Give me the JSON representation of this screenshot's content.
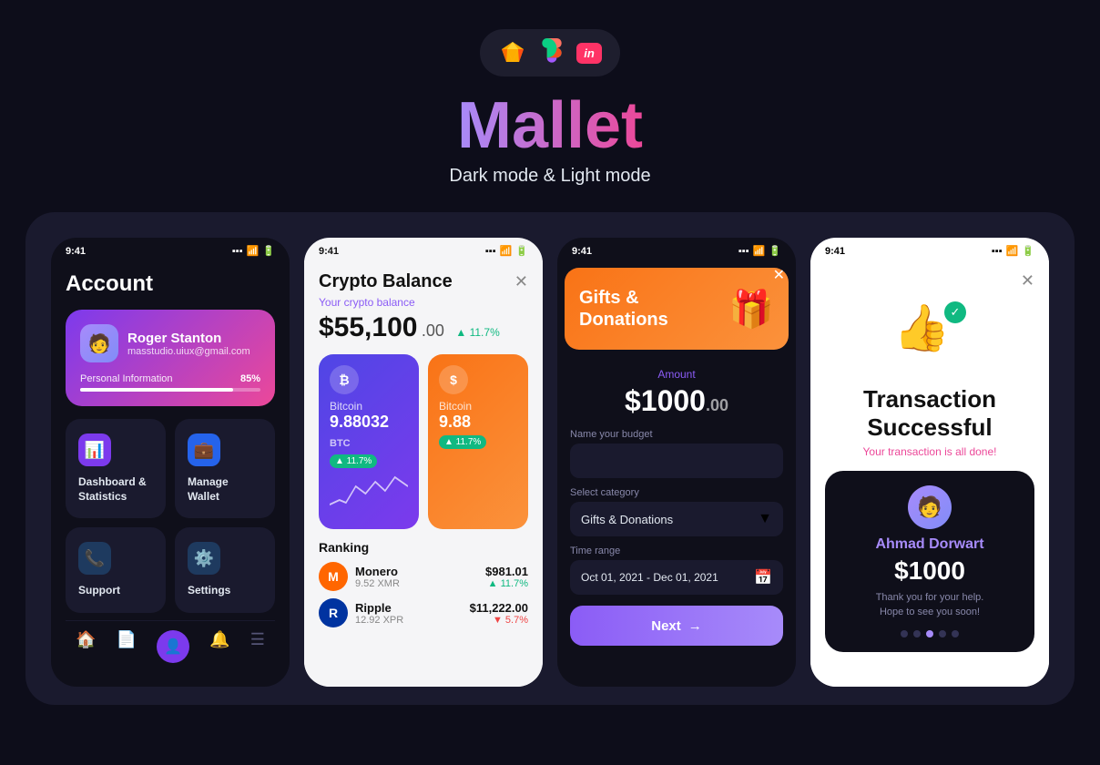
{
  "header": {
    "title": "Mallet",
    "subtitle": "Dark mode & Light mode",
    "tools": [
      "sketch",
      "figma",
      "invision"
    ]
  },
  "phone1": {
    "status_time": "9:41",
    "title": "Account",
    "user": {
      "name": "Roger Stanton",
      "email": "masstudio.uiux@gmail.com",
      "progress": 85,
      "progress_label": "Personal Information",
      "progress_pct": "85%"
    },
    "menu": [
      {
        "label": "Dashboard &\nStatistics",
        "icon": "📊",
        "icon_class": "menu-icon-dashboard"
      },
      {
        "label": "Manage\nWallet",
        "icon": "💼",
        "icon_class": "menu-icon-wallet"
      },
      {
        "label": "Support",
        "icon": "📞",
        "icon_class": "menu-icon-support"
      },
      {
        "label": "Settings",
        "icon": "⚙️",
        "icon_class": "menu-icon-settings"
      }
    ]
  },
  "phone2": {
    "status_time": "9:41",
    "title": "Crypto Balance",
    "balance_label": "Your crypto balance",
    "balance": "$55,100",
    "balance_cents": ".00",
    "balance_change": "▲ 11.7%",
    "cards": [
      {
        "icon": "₿",
        "name": "Bitcoin",
        "value": "9.88032",
        "unit": "BTC",
        "change": "▲ 11.7%"
      },
      {
        "icon": "$",
        "name": "Bitcoin",
        "value": "9.88",
        "unit": "",
        "change": "▲ 11.7%"
      }
    ],
    "ranking_title": "Ranking",
    "coins": [
      {
        "name": "Monero",
        "amount": "9.52 XMR",
        "price": "$981.01",
        "change": "▲ 11.7%",
        "change_up": true,
        "icon": "M"
      },
      {
        "name": "Ripple",
        "amount": "12.92 XPR",
        "price": "$11,222.00",
        "change": "▼ 5.7%",
        "change_up": false,
        "icon": "R"
      }
    ]
  },
  "phone3": {
    "status_time": "9:41",
    "banner_title": "Gifts &\nDonations",
    "amount_label": "Amount",
    "amount": "$1000",
    "amount_cents": ".00",
    "budget_label": "Name your budget",
    "category_label": "Select category",
    "category_value": "Gifts & Donations",
    "time_label": "Time range",
    "time_value": "Oct 01, 2021 - Dec 01, 2021",
    "next_btn": "Next"
  },
  "phone4": {
    "status_time": "9:41",
    "title": "Transaction\nSuccessful",
    "subtitle": "Your transaction is all done!",
    "recipient_name": "Ahmad Dorwart",
    "amount": "$1000",
    "message1": "Thank you for your help.",
    "message2": "Hope to see you soon!"
  }
}
